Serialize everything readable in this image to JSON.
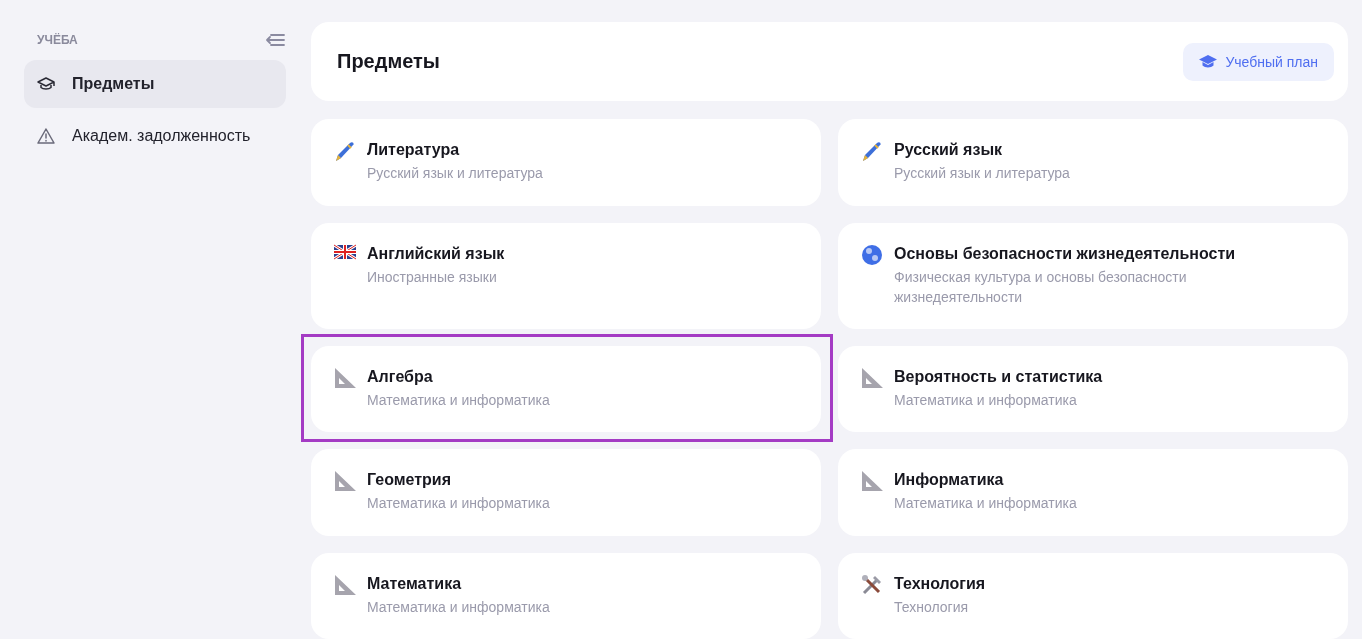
{
  "sidebar": {
    "section_label": "УЧЁБА",
    "items": [
      {
        "label": "Предметы",
        "kind": "cap",
        "selected": true
      },
      {
        "label": "Академ. задолженность",
        "kind": "warning",
        "selected": false
      }
    ]
  },
  "header": {
    "title": "Предметы",
    "button": "Учебный план"
  },
  "subjects": [
    {
      "title": "Литература",
      "subtitle": "Русский язык и литература",
      "kind": "pen",
      "highlighted": false
    },
    {
      "title": "Русский язык",
      "subtitle": "Русский язык и литература",
      "kind": "pen",
      "highlighted": false
    },
    {
      "title": "Английский язык",
      "subtitle": "Иностранные языки",
      "kind": "flag",
      "highlighted": false
    },
    {
      "title": "Основы безопасности жизнедеятельности",
      "subtitle": "Физическая культура и основы безопасности жизнедеятельности",
      "kind": "globe",
      "highlighted": false
    },
    {
      "title": "Алгебра",
      "subtitle": "Математика и информатика",
      "kind": "triangle",
      "highlighted": true
    },
    {
      "title": "Вероятность и статистика",
      "subtitle": "Математика и информатика",
      "kind": "triangle",
      "highlighted": false
    },
    {
      "title": "Геометрия",
      "subtitle": "Математика и информатика",
      "kind": "triangle",
      "highlighted": false
    },
    {
      "title": "Информатика",
      "subtitle": "Математика и информатика",
      "kind": "triangle",
      "highlighted": false
    },
    {
      "title": "Математика",
      "subtitle": "Математика и информатика",
      "kind": "triangle",
      "highlighted": false
    },
    {
      "title": "Технология",
      "subtitle": "Технология",
      "kind": "tools",
      "highlighted": false
    }
  ]
}
